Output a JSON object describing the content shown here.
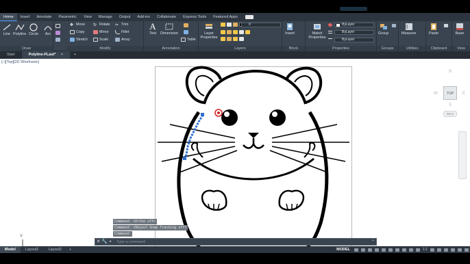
{
  "menubar": {
    "tabs": [
      "Home",
      "Insert",
      "Annotate",
      "Parametric",
      "View",
      "Manage",
      "Output",
      "Add-ins",
      "Collaborate",
      "Express Tools",
      "Featured Apps"
    ],
    "active": "Home"
  },
  "ribbon": {
    "draw": {
      "title": "Draw",
      "line": "Line",
      "polyline": "Polyline",
      "circle": "Circle",
      "arc": "Arc"
    },
    "modify": {
      "title": "Modify",
      "move": "Move",
      "rotate": "Rotate",
      "trim": "Trim",
      "copy": "Copy",
      "mirror": "Mirror",
      "fillet": "Fillet",
      "stretch": "Stretch",
      "scale": "Scale",
      "array": "Array"
    },
    "annotation": {
      "title": "Annotation",
      "text": "Text",
      "dimension": "Dimension",
      "table": "Table"
    },
    "layers": {
      "title": "Layers",
      "layer_properties": "Layer Properties",
      "current_layer": "0"
    },
    "block": {
      "title": "Block",
      "insert": "Insert"
    },
    "properties": {
      "title": "Properties",
      "match_properties": "Match Properties",
      "color": "ByLayer",
      "linetype": "ByLayer",
      "lineweight": "ByLayer"
    },
    "groups": {
      "title": "Groups",
      "group": "Group"
    },
    "utilities": {
      "title": "Utilities",
      "measure": "Measure"
    },
    "clipboard": {
      "title": "Clipboard",
      "paste": "Paste"
    },
    "view": {
      "title": "View",
      "base": "Base"
    }
  },
  "filetabs": {
    "start": "Start",
    "current": "Polyline-FLast*",
    "close": "×",
    "add": "+"
  },
  "viewport": {
    "label": "[–][Top][2D Wireframe]"
  },
  "viewcube": {
    "top": "TOP",
    "north": "N",
    "south": "S",
    "west": "W",
    "east": "E",
    "wcs": "WCS"
  },
  "command": {
    "history": [
      "Command: <Ortho off>",
      "Command: <Object Snap Tracking off>",
      "Command:"
    ],
    "placeholder": "Type a command",
    "close": "✕",
    "settings": "🔧"
  },
  "ucs": {
    "y": "Y"
  },
  "statusbar": {
    "tabs": [
      "Model",
      "Layout1",
      "Layout2"
    ],
    "active": "Model",
    "add": "+",
    "model_label": "MODEL",
    "scale": "1:1"
  },
  "colors": {
    "ribbon": "#3a4450",
    "dark": "#2d3640",
    "accent": "#4aa3ff",
    "canvas": "#ffffff",
    "selection": "#2f6fd0"
  }
}
